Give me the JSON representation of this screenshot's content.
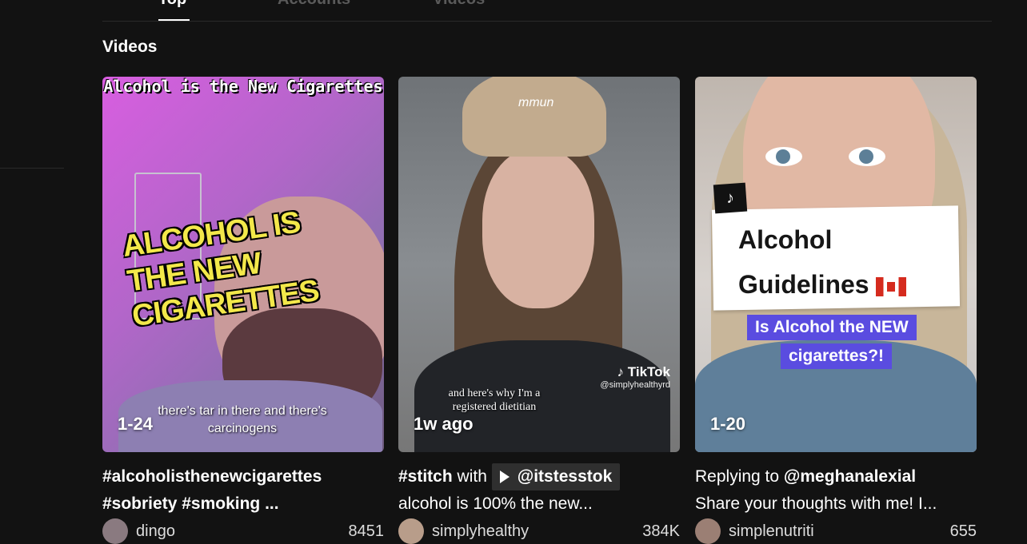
{
  "tabs": [
    {
      "label": "Top"
    },
    {
      "label": "Accounts"
    },
    {
      "label": "Videos"
    }
  ],
  "section_title": "Videos",
  "videos": [
    {
      "badge": "1-24",
      "overlay_top": "Alcohol is the New Cigarettes",
      "overlay_big": "ALCOHOL IS THE NEW CIGARETTES",
      "overlay_bottom": "there's tar in there and there's carcinogens",
      "desc_line1": "#alcoholisthenewcigarettes",
      "desc_line2": "#sobriety #smoking ...",
      "author": "dingo",
      "likes": "8451"
    },
    {
      "badge": "1w ago",
      "cap_logo": "mmun",
      "watermark_logo": "TikTok",
      "watermark_handle": "@simplyhealthyrd",
      "overlay_caption": "and here's why I'm a registered dietitian",
      "desc_tag": "#stitch",
      "desc_with": "with",
      "desc_mention": "@itstesstok",
      "desc_line2": "alcohol is 100% the new...",
      "author": "simplyhealthy",
      "likes": "384K"
    },
    {
      "badge": "1-20",
      "tiktok_icon": "♪",
      "box_line1": "Alcohol",
      "box_line2": "Guidelines",
      "sub_line1": "Is Alcohol the NEW",
      "sub_line2": "cigarettes?!",
      "desc_prefix": "Replying to",
      "desc_mention": "@meghanalexial",
      "desc_line2": "Share your thoughts with me! I...",
      "author": "simplenutriti",
      "likes": "655"
    }
  ]
}
